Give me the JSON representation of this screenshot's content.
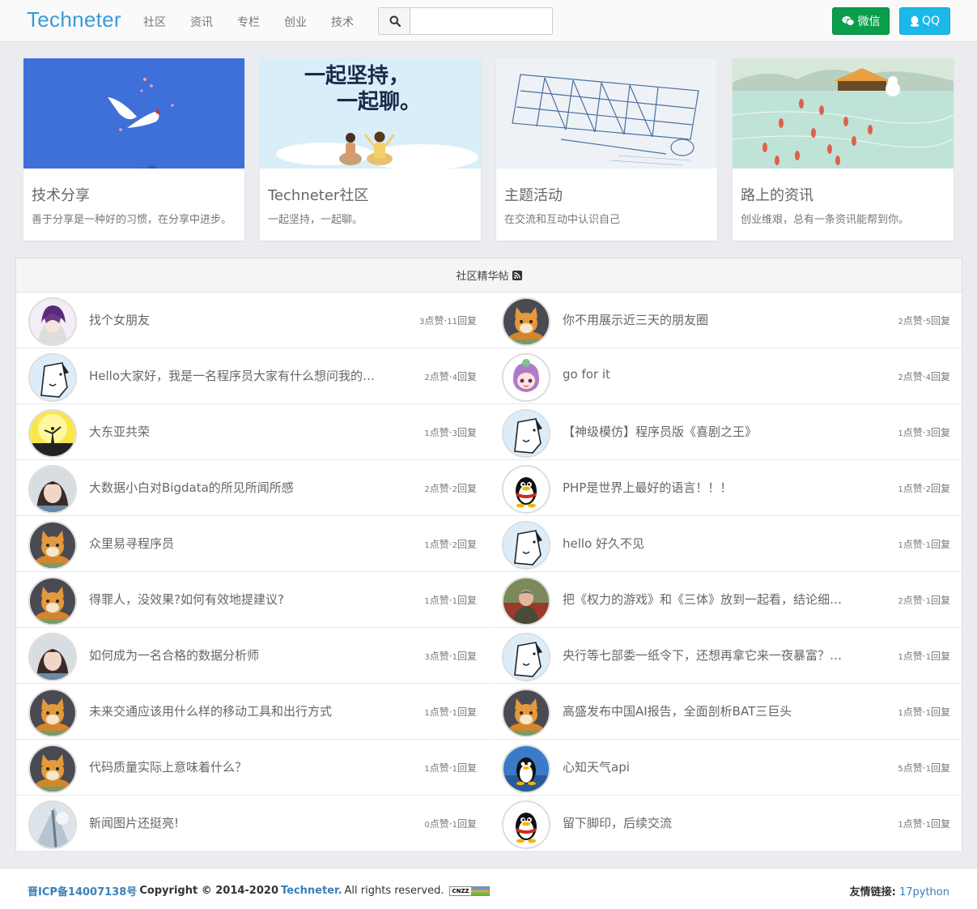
{
  "nav": {
    "brand": "Techneter",
    "items": [
      "社区",
      "资讯",
      "专栏",
      "创业",
      "技术"
    ],
    "search_placeholder": "",
    "wechat_label": "微信",
    "qq_label": "QQ"
  },
  "cards": [
    {
      "title": "技术分享",
      "desc": "善于分享是一种好的习惯，在分享中进步。"
    },
    {
      "title": "Techneter社区",
      "desc": "一起坚持，一起聊。"
    },
    {
      "title": "主题活动",
      "desc": "在交流和互动中认识自己"
    },
    {
      "title": "路上的资讯",
      "desc": "创业维艰，总有一条资讯能帮到你。"
    }
  ],
  "card_banner_text": [
    "一起坚持，",
    "一起聊。"
  ],
  "panel": {
    "title": "社区精华帖"
  },
  "posts_left": [
    {
      "title": "找个女朋友",
      "likes": "3",
      "replies": "11",
      "avatar": "anime-purple"
    },
    {
      "title": "Hello大家好，我是一名程序员大家有什么想问我的可以问",
      "likes": "2",
      "replies": "4",
      "avatar": "dog"
    },
    {
      "title": "大东亚共荣",
      "likes": "1",
      "replies": "3",
      "avatar": "sunset"
    },
    {
      "title": "大数据小白对Bigdata的所见所闻所感",
      "likes": "2",
      "replies": "2",
      "avatar": "girl"
    },
    {
      "title": "众里易寻程序员",
      "likes": "1",
      "replies": "2",
      "avatar": "cat"
    },
    {
      "title": "得罪人，没效果?如何有效地提建议?",
      "likes": "1",
      "replies": "1",
      "avatar": "cat"
    },
    {
      "title": "如何成为一名合格的数据分析师",
      "likes": "3",
      "replies": "1",
      "avatar": "girl"
    },
    {
      "title": "未来交通应该用什么样的移动工具和出行方式",
      "likes": "1",
      "replies": "1",
      "avatar": "cat"
    },
    {
      "title": "代码质量实际上意味着什么？",
      "likes": "1",
      "replies": "1",
      "avatar": "cat"
    },
    {
      "title": "新闻图片还挺亮!",
      "likes": "0",
      "replies": "1",
      "avatar": "photo"
    }
  ],
  "posts_right": [
    {
      "title": "你不用展示近三天的朋友圈",
      "likes": "2",
      "replies": "5",
      "avatar": "cat"
    },
    {
      "title": "go for it",
      "likes": "2",
      "replies": "4",
      "avatar": "cartoon-girl"
    },
    {
      "title": "【神级模仿】程序员版《喜剧之王》",
      "likes": "1",
      "replies": "3",
      "avatar": "dog"
    },
    {
      "title": "PHP是世界上最好的语言！！！",
      "likes": "1",
      "replies": "2",
      "avatar": "penguin"
    },
    {
      "title": "hello 好久不见",
      "likes": "1",
      "replies": "1",
      "avatar": "dog"
    },
    {
      "title": "把《权力的游戏》和《三体》放到一起看，结论细思极恐",
      "likes": "2",
      "replies": "1",
      "avatar": "man"
    },
    {
      "title": "央行等七部委一纸令下，还想再拿它来一夜暴富？别想了",
      "likes": "1",
      "replies": "1",
      "avatar": "dog"
    },
    {
      "title": "高盛发布中国AI报告，全面剖析BAT三巨头",
      "likes": "1",
      "replies": "1",
      "avatar": "cat"
    },
    {
      "title": "心知天气api",
      "likes": "5",
      "replies": "1",
      "avatar": "tux"
    },
    {
      "title": "留下脚印，后续交流",
      "likes": "1",
      "replies": "1",
      "avatar": "penguin"
    }
  ],
  "stats_labels": {
    "likes": "点赞",
    "sep": "·",
    "replies": "回复"
  },
  "footer": {
    "icp": "晋ICP备14007138号",
    "copyright": "Copyright © 2014-2020",
    "brand": "Techneter.",
    "rights": "All rights reserved.",
    "cnzz": "CNZZ",
    "friends_label": "友情链接:",
    "friend_link": "17python"
  },
  "colors": {
    "brand": "#3a9bd9",
    "wechat": "#0a9e4c",
    "qq": "#1eb8e8",
    "link": "#3a7fb8"
  }
}
